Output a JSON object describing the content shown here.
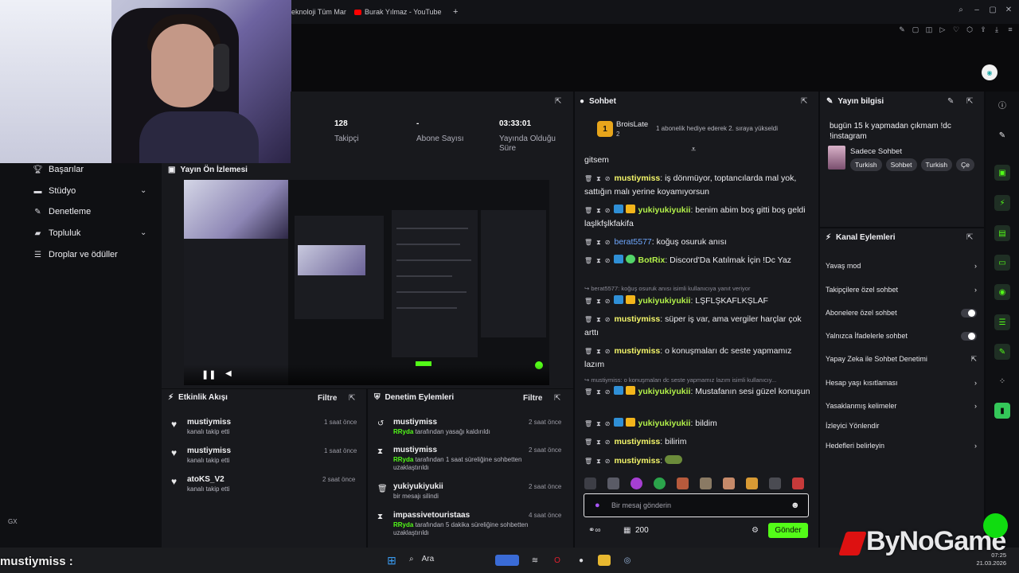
{
  "browser": {
    "tabs": [
      {
        "label": "eknoloji Tüm Mar"
      },
      {
        "label": "Burak Yılmaz - YouTube"
      },
      {
        "label": "+"
      }
    ]
  },
  "stats": {
    "followers": {
      "value": "128",
      "label": "Takipçi"
    },
    "subs": {
      "value": "-",
      "label": "Abone Sayısı"
    },
    "duration": {
      "value": "03:33:01",
      "label": "Yayında Olduğu Süre"
    }
  },
  "nav": {
    "items": [
      {
        "label": "Başarılar",
        "icon": "trophy-icon"
      },
      {
        "label": "Stüdyo",
        "icon": "studio-icon",
        "expandable": true
      },
      {
        "label": "Denetleme",
        "icon": "wrench-icon"
      },
      {
        "label": "Topluluk",
        "icon": "community-icon",
        "expandable": true
      },
      {
        "label": "Droplar ve ödüller",
        "icon": "drops-icon"
      }
    ],
    "footer": "GX"
  },
  "preview": {
    "title": "Yayın Ön İzlemesi"
  },
  "events": {
    "title": "Etkinlik Akışı",
    "filter": "Filtre",
    "items": [
      {
        "name": "mustiymiss",
        "sub": "kanalı takip etti",
        "time": "1 saat önce"
      },
      {
        "name": "mustiymiss",
        "sub": "kanalı takip etti",
        "time": "1 saat önce"
      },
      {
        "name": "atoKS_V2",
        "sub": "kanalı takip etti",
        "time": "2 saat önce"
      }
    ]
  },
  "mod": {
    "title": "Denetim Eylemleri",
    "filter": "Filtre",
    "items": [
      {
        "name": "mustiymiss",
        "actor": "RRyda",
        "sub": " tarafından yasağı kaldırıldı",
        "time": "2 saat önce"
      },
      {
        "name": "mustiymiss",
        "actor": "RRyda",
        "sub": " tarafından 1 saat süreliğine sohbetten uzaklaştırıldı",
        "time": "2 saat önce"
      },
      {
        "name": "yukiyukiyukii",
        "actor": "",
        "sub": "bir mesajı silindi",
        "time": "2 saat önce"
      },
      {
        "name": "impassivetouristaas",
        "actor": "RRyda",
        "sub": " tarafından 5 dakika süreliğine sohbetten uzaklaştırıldı",
        "time": "4 saat önce"
      }
    ]
  },
  "chat": {
    "title": "Sohbet",
    "pinned": {
      "user": "BroisLate",
      "count": "2",
      "text": "1 abonelik hediye ederek 2. sıraya yükseldi"
    },
    "messages": [
      {
        "text": "gitsem"
      },
      {
        "user": "mustiymiss",
        "text": ": iş dönmüyor, toptancılarda mal yok, sattığın malı yerine koyamıyorsun"
      },
      {
        "user": "yukiyukiyukii",
        "text": ": benim abim boş gitti boş geldi laşlkfşlkfakifa"
      },
      {
        "user": "berat5577",
        "text": ": koğuş osuruk anısı"
      },
      {
        "user": "BotRix",
        "text": ": Discord'Da Katılmak İçin !Dc Yaz"
      },
      {
        "reply": "berat5577: koğuş osuruk anısı isimli kullanıcıya yanıt veriyor"
      },
      {
        "user": "yukiyukiyukii",
        "text": ": LŞFLŞKAFLKŞLAF"
      },
      {
        "user": "mustiymiss",
        "text": ": süper iş var, ama vergiler harçlar çok arttı"
      },
      {
        "user": "mustiymiss",
        "text": ": o konuşmaları dc seste yapmamız lazım"
      },
      {
        "reply": "mustiymiss: o konuşmaları dc seste yapmamız lazım isimli kullanıcıy..."
      },
      {
        "user": "yukiyukiyukii",
        "text": ": Mustafanın sesi güzel konuşun"
      },
      {
        "user": "yukiyukiyukii",
        "text": ": bildim"
      },
      {
        "user": "mustiymiss",
        "text": ": bilirim"
      },
      {
        "user": "mustiymiss",
        "text": ": "
      }
    ],
    "input_placeholder": "Bir mesaj gönderin",
    "points": "200",
    "send_label": "Gönder"
  },
  "info": {
    "title": "Yayın bilgisi",
    "stream_title": "bugün 15 k yapmadan çıkmam !dc !instagram",
    "category": "Sadece Sohbet",
    "tags": [
      "Turkish",
      "Sohbet",
      "Turkish",
      "Çe"
    ]
  },
  "actions": {
    "title": "Kanal Eylemleri",
    "items": [
      {
        "label": "Yavaş mod",
        "control": "arrow"
      },
      {
        "label": "Takipçilere özel sohbet",
        "control": "arrow"
      },
      {
        "label": "Abonelere özel sohbet",
        "control": "toggle"
      },
      {
        "label": "Yalnızca İfadelerle sohbet",
        "control": "toggle"
      },
      {
        "label": "Yapay Zeka ile Sohbet Denetimi",
        "control": "external"
      },
      {
        "label": "Hesap yaşı kısıtlaması",
        "control": "arrow"
      },
      {
        "label": "Yasaklanmış kelimeler",
        "control": "arrow"
      },
      {
        "label": "İzleyici Yönlendir",
        "control": ""
      },
      {
        "label": "Hedefleri belirleyin",
        "control": "arrow"
      }
    ]
  },
  "taskbar": {
    "search": "Ara",
    "time": "07:25",
    "date": "21.03.2026"
  },
  "overlay": {
    "chat_user": "mustiymiss :",
    "watermark": "ByNoGame"
  },
  "colors": {
    "accent": "#53fc18",
    "panel": "#18191d",
    "bg": "#0c0d10"
  }
}
